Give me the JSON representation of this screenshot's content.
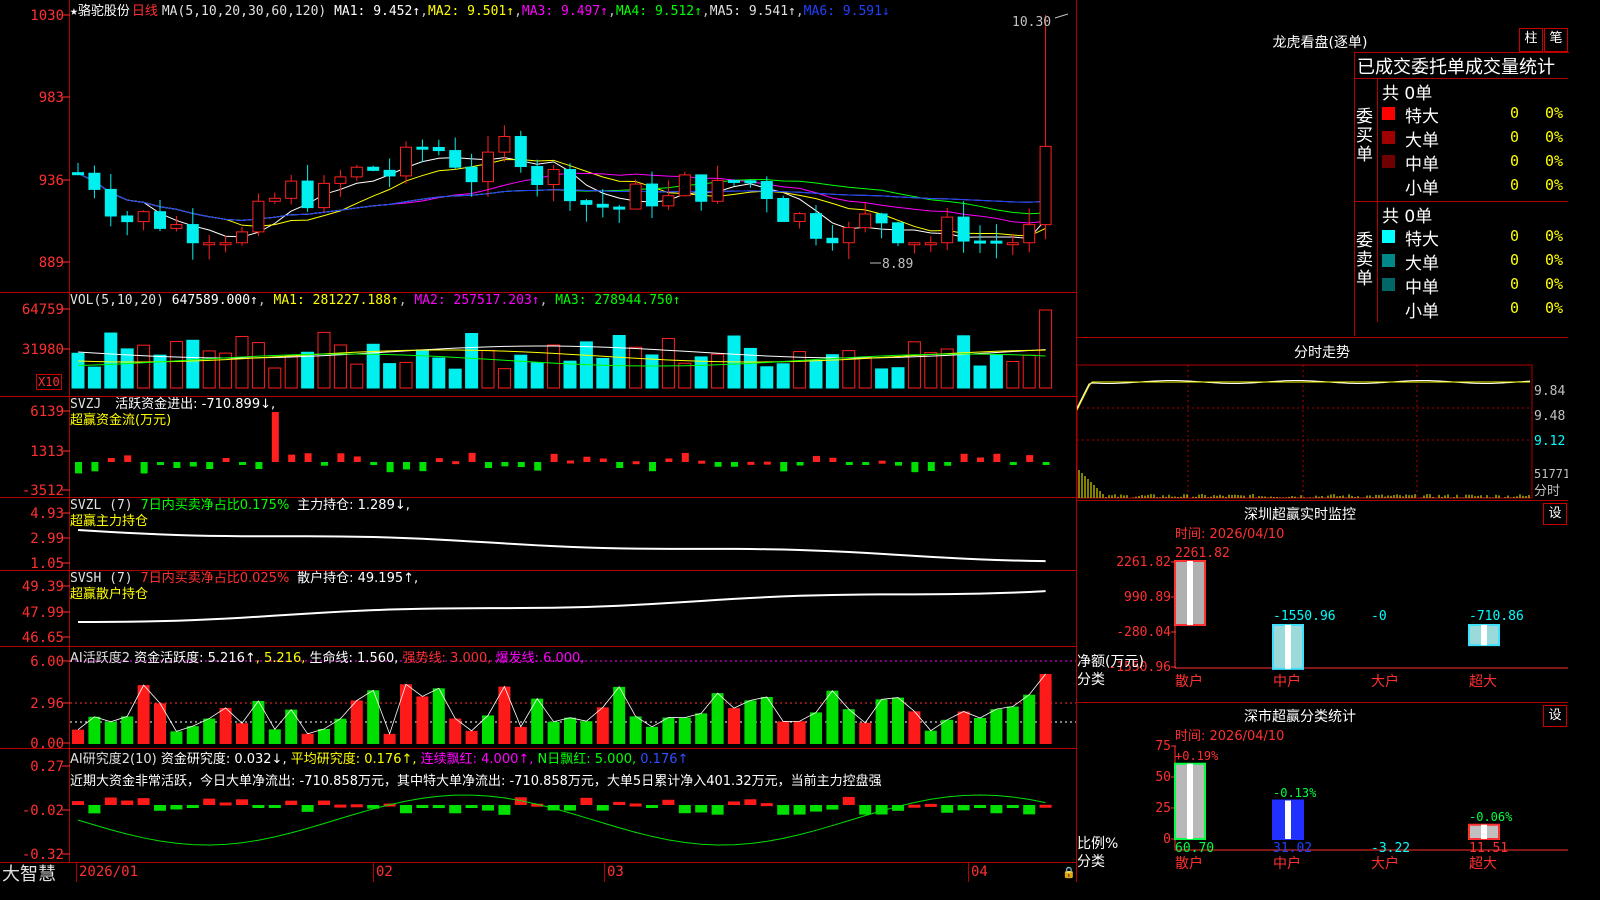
{
  "colors": {
    "up": "#ff2020",
    "down": "#00f0f0",
    "grid": "#b00000",
    "ma1": "#ffffff",
    "ma2": "#ffff00",
    "ma3": "#ff00ff",
    "ma4": "#00ff00",
    "ma6": "#1c3cff"
  },
  "main": {
    "star": "★",
    "stock_name": "骆驼股份",
    "period": "日线",
    "ma_def": "MA(5,10,20,30,60,120)",
    "ma1": "MA1: 9.452↑",
    "ma2": "MA2: 9.501↑",
    "ma3": "MA3: 9.497↑",
    "ma4": "MA4: 9.512↑",
    "ma5": "MA5: 9.541↑",
    "ma6": "MA6: 9.591↓",
    "y_ticks": [
      "1030",
      "983",
      "936",
      "889"
    ],
    "high_mark": "10.30",
    "low_mark": "8.89"
  },
  "vol": {
    "header": "VOL(5,10,20)",
    "vol": "647589.000↑",
    "ma1": "MA1: 281227.188↑",
    "ma2": "MA2: 257517.203↑",
    "ma3": "MA3: 278944.750↑",
    "y_ticks": [
      "64759",
      "31980"
    ],
    "unit": "X10"
  },
  "svzj": {
    "header": "SVZJ",
    "label": "活跃资金进出: -710.899↓,",
    "sub": "超赢资金流(万元)",
    "y_ticks": [
      "6139",
      "1313",
      "-3512"
    ]
  },
  "svzl": {
    "header": "SVZL (7)",
    "label1": "7日内买卖净占比0.175%",
    "label2": "主力持仓: 1.289↓,",
    "sub": "超赢主力持仓",
    "y_ticks": [
      "4.93",
      "2.99",
      "1.05"
    ]
  },
  "svsh": {
    "header": "SVSH (7)",
    "label1": "7日内买卖净占比0.025%",
    "label2": "散户持仓: 49.195↑,",
    "sub": "超赢散户持仓",
    "y_ticks": [
      "49.39",
      "47.99",
      "46.65"
    ]
  },
  "ai1": {
    "header": "AI活跃度2",
    "label1": "资金活跃度: 5.216↑",
    "label1b": ", 5.216,",
    "label2": "生命线: 1.560,",
    "label3": "强势线: 3.000,",
    "label4": "爆发线: 6.000,",
    "y_ticks": [
      "6.00",
      "2.96",
      "0.00"
    ]
  },
  "ai2": {
    "header": "AI研究度2(10)",
    "label1": "资金研究度: 0.032↓,",
    "label2": "平均研究度: 0.176↑,",
    "label3": "连续飘红: 4.000↑,",
    "label4": "N日飘红: 5.000,",
    "label5": "0.176↑",
    "summary": "近期大资金非常活跃，今日大单净流出: -710.858万元，其中特大单净流出: -710.858万元，大单5日累计净入401.32万元，当前主力控盘强",
    "y_ticks": [
      "0.27",
      "-0.02",
      "-0.32"
    ]
  },
  "bottom": {
    "brand": "大智慧",
    "dates": [
      "2026/01",
      "02",
      "03",
      "04"
    ]
  },
  "lhb": {
    "title": "龙虎看盘(逐单)",
    "btn_bar": "柱",
    "btn_pen": "笔",
    "subtitle": "已成交委托单成交量统计",
    "buy_side": "委买单",
    "sell_side": "委卖单",
    "buy_total": "共 0单",
    "sell_total": "共 0单",
    "rows": [
      {
        "label": "特大",
        "count": "0",
        "pct": "0%",
        "buy_color": "#ff0000",
        "sell_color": "#00ffff"
      },
      {
        "label": "大单",
        "count": "0",
        "pct": "0%",
        "buy_color": "#a00000",
        "sell_color": "#008888"
      },
      {
        "label": "中单",
        "count": "0",
        "pct": "0%",
        "buy_color": "#700000",
        "sell_color": "#006666"
      },
      {
        "label": "小单",
        "count": "0",
        "pct": "0%",
        "buy_color": "#000000",
        "sell_color": "#000000"
      }
    ]
  },
  "intraday": {
    "title": "分时走势",
    "prices": [
      "9.84",
      "9.48",
      "9.12"
    ],
    "vol": "51771",
    "unit": "分时"
  },
  "sz_monitor": {
    "title": "深圳超赢实时监控",
    "btn": "设",
    "time": "时间: 2026/04/10",
    "y_ticks": [
      "2261.82",
      "990.89",
      "-280.04",
      "-1550.96"
    ],
    "y_label1": "净额(万元)",
    "y_label2": "分类",
    "categories": [
      "散户",
      "中户",
      "大户",
      "超大"
    ],
    "values": [
      2261.82,
      -1550.96,
      0,
      -710.86
    ],
    "value_labels": [
      "2261.82",
      "-1550.96",
      "-0",
      "-710.86"
    ]
  },
  "sz_class": {
    "title": "深市超赢分类统计",
    "btn": "设",
    "time": "时间: 2026/04/10",
    "y_ticks": [
      "75",
      "50",
      "25",
      "0"
    ],
    "y_label1": "比例%",
    "y_label2": "分类",
    "categories": [
      "散户",
      "中户",
      "大户",
      "超大"
    ],
    "changes": [
      "+0.19%",
      "-0.13%",
      "",
      "-0.06%"
    ],
    "values": [
      60.7,
      31.02,
      -3.22,
      11.51
    ],
    "value_labels": [
      "60.70",
      "31.02",
      "-3.22",
      "11.51"
    ]
  }
}
